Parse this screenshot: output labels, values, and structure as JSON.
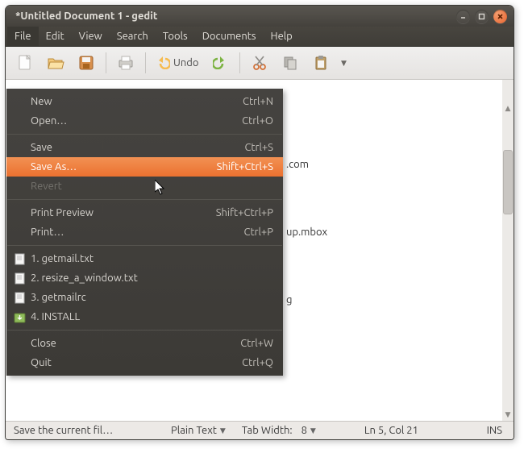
{
  "window": {
    "title": "*Untitled Document 1 - gedit"
  },
  "menubar": {
    "items": [
      "File",
      "Edit",
      "View",
      "Search",
      "Tools",
      "Documents",
      "Help"
    ]
  },
  "toolbar": {
    "undo_label": "Undo"
  },
  "filemenu": {
    "groups": [
      [
        {
          "label": "New",
          "accel": "Ctrl+N"
        },
        {
          "label": "Open…",
          "accel": "Ctrl+O"
        }
      ],
      [
        {
          "label": "Save",
          "accel": "Ctrl+S"
        },
        {
          "label": "Save As…",
          "accel": "Shift+Ctrl+S",
          "hover": true
        },
        {
          "label": "Revert",
          "accel": "",
          "disabled": true
        }
      ],
      [
        {
          "label": "Print Preview",
          "accel": "Shift+Ctrl+P"
        },
        {
          "label": "Print…",
          "accel": "Ctrl+P"
        }
      ],
      [
        {
          "label": "1. getmail.txt",
          "accel": "",
          "icon": "doc"
        },
        {
          "label": "2. resize_a_window.txt",
          "accel": "",
          "icon": "doc"
        },
        {
          "label": "3. getmailrc",
          "accel": "",
          "icon": "doc"
        },
        {
          "label": "4. INSTALL",
          "accel": "",
          "icon": "install"
        }
      ],
      [
        {
          "label": "Close",
          "accel": "Ctrl+W"
        },
        {
          "label": "Quit",
          "accel": "Ctrl+Q"
        }
      ]
    ]
  },
  "editor": {
    "visible_lines": [
      ".com",
      "",
      "",
      "up.mbox",
      "",
      "",
      "g"
    ]
  },
  "statusbar": {
    "hint": "Save the current fil…",
    "syntax": "Plain Text",
    "tabwidth_label": "Tab Width:",
    "tabwidth_value": "8",
    "position": "Ln 5, Col 21",
    "insert_mode": "INS"
  }
}
